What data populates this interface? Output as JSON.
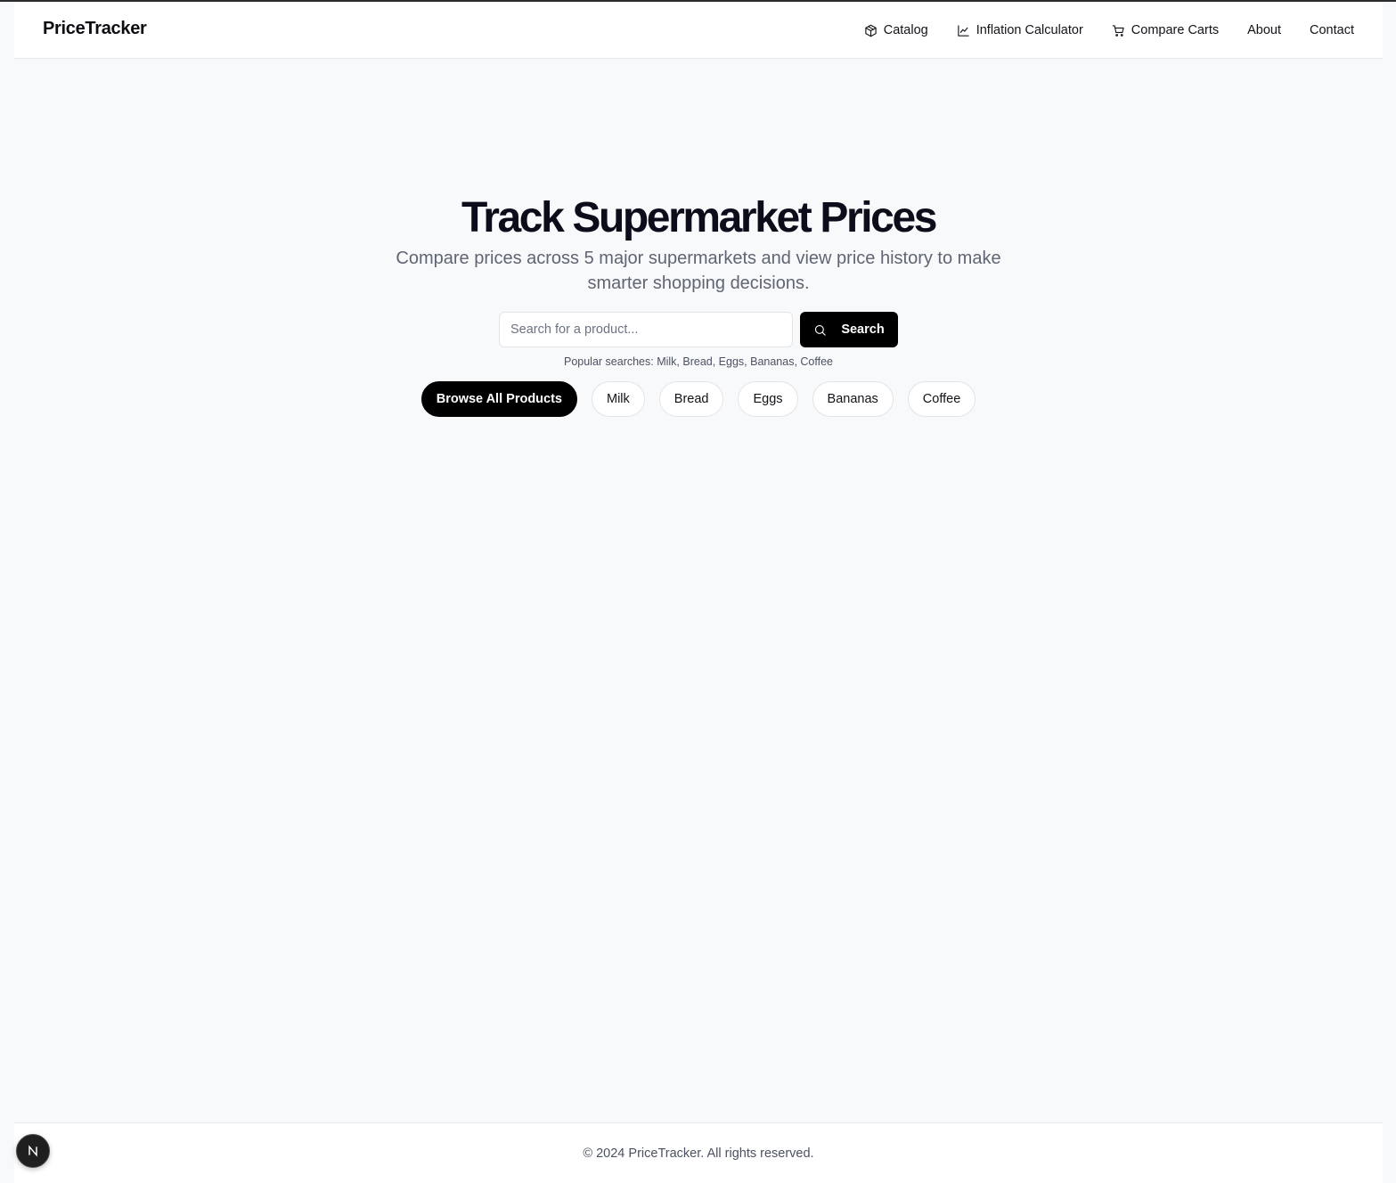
{
  "brand": "PriceTracker",
  "nav": {
    "items": [
      {
        "label": "Catalog",
        "icon": "package-icon"
      },
      {
        "label": "Inflation Calculator",
        "icon": "line-chart-icon"
      },
      {
        "label": "Compare Carts",
        "icon": "cart-icon"
      },
      {
        "label": "About"
      },
      {
        "label": "Contact"
      }
    ]
  },
  "hero": {
    "title": "Track Supermarket Prices",
    "subtitle": "Compare prices across 5 major supermarkets and view price history to make smarter shopping decisions."
  },
  "search": {
    "placeholder": "Search for a product...",
    "value": "",
    "button_label": "Search",
    "popular_text": "Popular searches: Milk, Bread, Eggs, Bananas, Coffee"
  },
  "chips": {
    "browse_all": "Browse All Products",
    "items": [
      "Milk",
      "Bread",
      "Eggs",
      "Bananas",
      "Coffee"
    ]
  },
  "footer": {
    "copyright": "© 2024 PriceTracker. All rights reserved."
  },
  "dev_badge": {
    "icon": "nextjs-n-icon"
  },
  "colors": {
    "page_bg": "#f8f9fa",
    "primary": "#000000",
    "text": "#111318",
    "muted": "#5f6572",
    "border": "#e2e4e8"
  }
}
